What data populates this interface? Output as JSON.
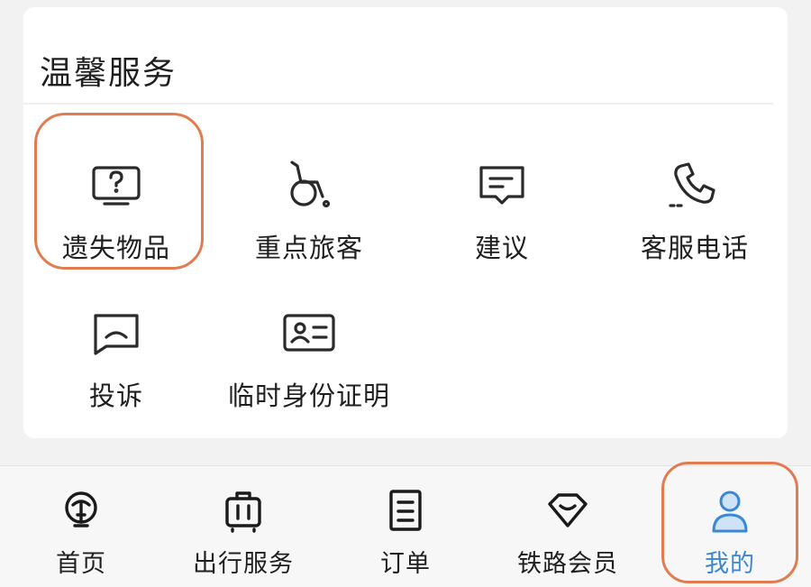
{
  "services": {
    "title": "温馨服务",
    "items": [
      {
        "label": "遗失物品",
        "icon": "question-box-icon"
      },
      {
        "label": "重点旅客",
        "icon": "wheelchair-icon"
      },
      {
        "label": "建议",
        "icon": "message-lines-icon"
      },
      {
        "label": "客服电话",
        "icon": "phone-icon"
      },
      {
        "label": "投诉",
        "icon": "sad-message-icon"
      },
      {
        "label": "临时身份证明",
        "icon": "id-card-icon"
      }
    ]
  },
  "tabbar": {
    "items": [
      {
        "label": "首页",
        "icon": "railway-logo-icon"
      },
      {
        "label": "出行服务",
        "icon": "luggage-icon"
      },
      {
        "label": "订单",
        "icon": "order-document-icon"
      },
      {
        "label": "铁路会员",
        "icon": "diamond-icon"
      },
      {
        "label": "我的",
        "icon": "person-icon"
      }
    ],
    "active_index": 4
  },
  "colors": {
    "highlight": "#e07b52",
    "active_tab": "#3b87d4",
    "active_icon_fill": "#cfe3f7"
  }
}
